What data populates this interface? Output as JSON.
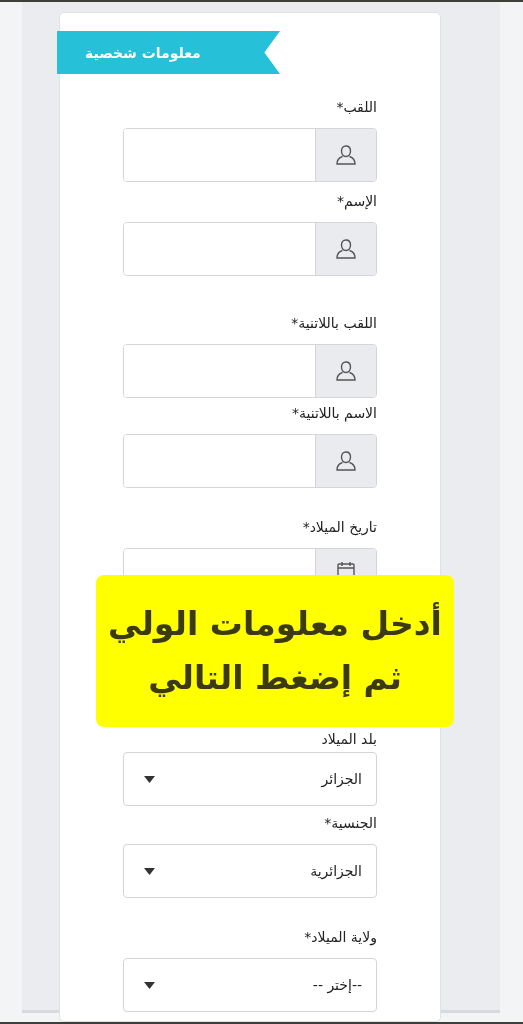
{
  "section_title": "معلومات شخصية",
  "fields": [
    {
      "kind": "text",
      "label": "اللقب*"
    },
    {
      "kind": "text",
      "label": "الإسم*"
    },
    {
      "kind": "text",
      "label": "اللقب باللاتنية*"
    },
    {
      "kind": "text",
      "label": "الاسم باللاتنية*"
    },
    {
      "kind": "date",
      "label": "تاريخ الميلاد*"
    },
    {
      "kind": "select",
      "label": "بلد الميلاد",
      "value": "الجزائر"
    },
    {
      "kind": "select",
      "label": "الجنسية*",
      "value": "الجزائرية"
    },
    {
      "kind": "select",
      "label": "ولاية الميلاد*",
      "value": "--إختر --"
    }
  ],
  "notice": {
    "lines": [
      "أدخل معلومات الولي",
      "ثم إضغط التالي"
    ]
  }
}
